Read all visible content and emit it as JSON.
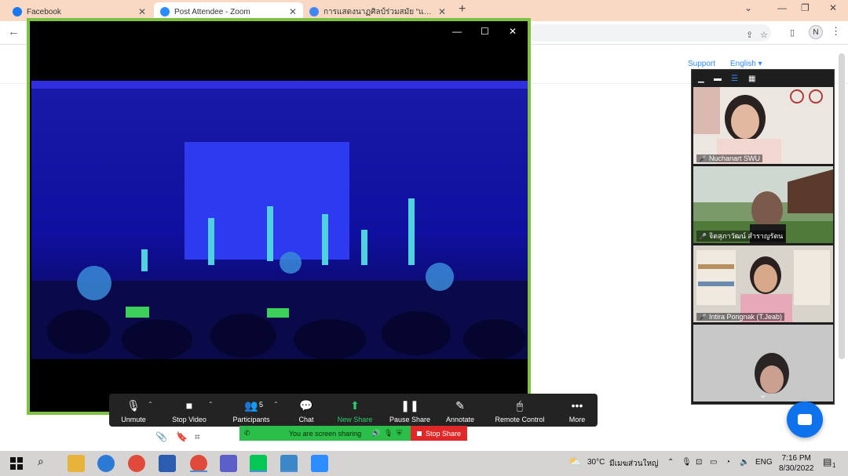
{
  "browser": {
    "tabs": [
      {
        "label": "Facebook",
        "favicon": "facebook-icon",
        "color": "#1877f2"
      },
      {
        "label": "Post Attendee - Zoom",
        "favicon": "zoom-icon",
        "color": "#2d8cff"
      },
      {
        "label": "การแสดงนาฏศิลป์ร่วมสมัย “แสง”",
        "favicon": "chrome-page-icon",
        "color": "#4285f4"
      }
    ],
    "profile_initial": "N"
  },
  "page": {
    "support_link": "Support",
    "language": "English"
  },
  "gallery": {
    "participants": [
      {
        "name": "Nuchanart SWU"
      },
      {
        "name": "จิตสุภาวัฒน์ สำราญรัตน"
      },
      {
        "name": "Intira Pongnak (T.Jeab)"
      },
      {
        "name": ""
      }
    ]
  },
  "toolbar": {
    "unmute": "Unmute",
    "stop_video": "Stop Video",
    "participants": "Participants",
    "participants_count": "5",
    "chat": "Chat",
    "new_share": "New Share",
    "pause_share": "Pause Share",
    "annotate": "Annotate",
    "remote_control": "Remote Control",
    "more": "More"
  },
  "share_banner": {
    "status": "You are screen sharing",
    "stop": "Stop Share"
  },
  "taskbar": {
    "weather": "30°C",
    "weather_desc": "มีเมฆส่วนใหญ่",
    "language": "ENG",
    "time": "7:16 PM",
    "date": "8/30/2022",
    "notification_count": "1"
  },
  "colors": {
    "share_border": "#7dc242",
    "accent": "#2d8cff",
    "stop_share": "#e02828",
    "sharing_green": "#2bbf49"
  }
}
